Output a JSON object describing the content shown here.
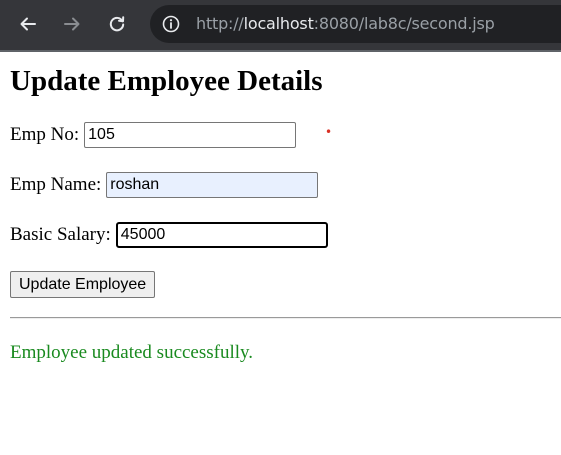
{
  "browser": {
    "url_prefix": "http://",
    "url_host": "localhost",
    "url_path": ":8080/lab8c/second.jsp",
    "icons": {
      "back": "arrow-left-icon",
      "forward": "arrow-right-icon",
      "reload": "reload-icon",
      "site_info": "info-icon"
    }
  },
  "page": {
    "title": "Update Employee Details",
    "form": {
      "emp_no_label": "Emp No:",
      "emp_no_value": "105",
      "emp_name_label": "Emp Name:",
      "emp_name_value": "roshan",
      "salary_label": "Basic Salary:",
      "salary_value": "45000",
      "submit_label": "Update Employee"
    },
    "status_message": "Employee updated successfully.",
    "colors": {
      "status": "#198a1f",
      "required_marker": "#d93025",
      "autofill_background": "#e8f0fe"
    }
  }
}
